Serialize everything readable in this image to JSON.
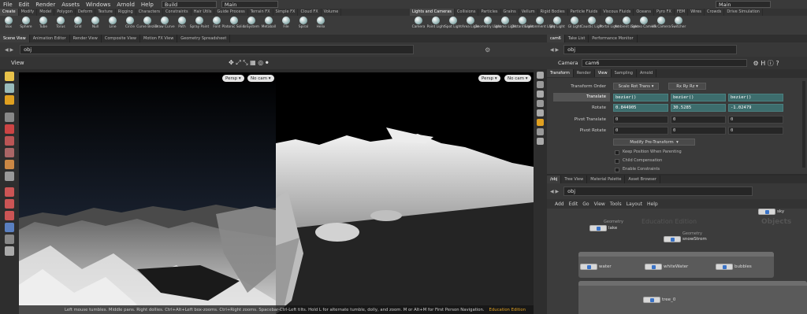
{
  "menubar": {
    "items": [
      "File",
      "Edit",
      "Render",
      "Assets",
      "Windows",
      "Arnold",
      "Help"
    ],
    "desktop": "Build",
    "obj": "Main",
    "right_obj": "Main"
  },
  "shelf_tabs_left": [
    "Create",
    "Modify",
    "Model",
    "Polygon",
    "Deform",
    "Texture",
    "Rigging",
    "Characters",
    "Constraints",
    "Hair Utils",
    "Guide Process",
    "Terrain FX",
    "Simple FX",
    "Cloud FX",
    "Volume"
  ],
  "shelf_tabs_right": [
    "Lights and Cameras",
    "Collisions",
    "Particles",
    "Grains",
    "Vellum",
    "Rigid Bodies",
    "Particle Fluids",
    "Viscous Fluids",
    "Oceans",
    "Pyro FX",
    "FEM",
    "Wires",
    "Crowds",
    "Drive Simulation"
  ],
  "tools_left": [
    "Box",
    "Sphere",
    "Tube",
    "Torus",
    "Grid",
    "Null",
    "Line",
    "Circle",
    "Curve Bezier",
    "Draw Curve",
    "Path",
    "Spray Paint",
    "Font",
    "Platonic Solids",
    "L-System",
    "Metaball",
    "File",
    "Spiral",
    "Helix"
  ],
  "tools_right": [
    "Camera",
    "Point Light",
    "Spot Light",
    "Area Light",
    "Geometry Light",
    "Volume Light",
    "Distant Light",
    "Environment Light",
    "Sky Light",
    "GI Light",
    "Caustic Light",
    "Portal Light",
    "Ambient Light",
    "Stereo Camera",
    "VR Camera",
    "Switcher"
  ],
  "pane_tabs_left": [
    "Scene View",
    "Animation Editor",
    "Render View",
    "Composite View",
    "Motion FX View",
    "Geometry Spreadsheet"
  ],
  "pane_tabs_right": [
    "cam6",
    "Take List",
    "Performance Monitor"
  ],
  "viewport": {
    "path": "obj",
    "label": "View",
    "left_persp": "Persp",
    "left_cam": "No cam",
    "right_persp": "Persp",
    "right_cam": "No cam",
    "status": "Left mouse tumbles. Middle pans. Right dollies. Ctrl+Alt+Left box-zooms. Ctrl+Right zooms. Spacebar-Ctrl-Left tilts. Hold L for alternate tumble, dolly, and zoom.    M or Alt+M for First Person Navigation.",
    "edition": "Education Edition"
  },
  "params": {
    "path": "obj",
    "type": "Camera",
    "name": "cam6",
    "tabs": [
      "Transform",
      "Render",
      "View",
      "Sampling",
      "Arnold"
    ],
    "transform_order_label": "Transform Order",
    "transform_order": "Scale Rot Trans",
    "rot_order": "Rx Ry Rz",
    "translate_label": "Translate",
    "translate": [
      "bezier()",
      "bezier()",
      "bezier()"
    ],
    "rotate_label": "Rotate",
    "rotate": [
      "0.844905",
      "30.5285",
      "-1.02479"
    ],
    "pivot_t_label": "Pivot Translate",
    "pivot_t": [
      "0",
      "0",
      "0"
    ],
    "pivot_r_label": "Pivot Rotate",
    "pivot_r": [
      "0",
      "0",
      "0"
    ],
    "modify_btn": "Modify Pre-Transform",
    "checks": [
      "Keep Position When Parenting",
      "Child Compensation",
      "Enable Constraints"
    ]
  },
  "network": {
    "tabs": [
      "/obj",
      "Tree View",
      "Material Palette",
      "Asset Browser"
    ],
    "path": "obj",
    "menu": [
      "Add",
      "Edit",
      "Go",
      "View",
      "Tools",
      "Layout",
      "Help"
    ],
    "watermark": "Education Edition",
    "context": "Objects",
    "nodes": {
      "sky": "sky",
      "lake_type": "Geometry",
      "lake": "lake",
      "snow_type": "Geometry",
      "snow": "snowStrom",
      "water": "water",
      "whitewater": "whiteWater",
      "bubbles": "bubbles",
      "tree": "tree_0"
    }
  },
  "colors": {
    "accent": "#e0a020",
    "param_hl": "#3d6d6d"
  }
}
